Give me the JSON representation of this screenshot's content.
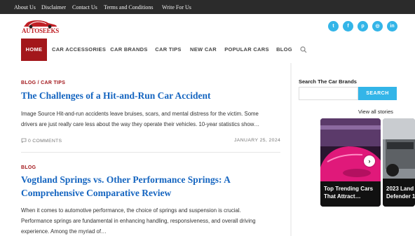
{
  "topbar": {
    "links": [
      "About Us",
      "Disclaimer",
      "Contact Us",
      "Terms and Conditions",
      "Write For Us"
    ]
  },
  "logo": {
    "text": "AUTOSEEKS"
  },
  "socials": [
    {
      "icon": "twitter-icon",
      "glyph": "t"
    },
    {
      "icon": "facebook-icon",
      "glyph": "f"
    },
    {
      "icon": "pinterest-icon",
      "glyph": "p"
    },
    {
      "icon": "instagram-icon",
      "glyph": "◎"
    },
    {
      "icon": "linkedin-icon",
      "glyph": "in"
    }
  ],
  "nav": {
    "items": [
      "HOME",
      "CAR ACCESSORIES",
      "CAR BRANDS",
      "CAR TIPS",
      "NEW CAR",
      "POPULAR CARS",
      "BLOG"
    ]
  },
  "posts": [
    {
      "category": "BLOG / CAR TIPS",
      "title": "The Challenges of a Hit-and-Run Car Accident",
      "excerpt_lines": [
        "Image Source Hit-and-run accidents leave bruises, scars, and mental distress for the victim. Some",
        "drivers are just really care less about the way they operate their vehicles. 10-year statistics show…"
      ],
      "comments": "0 COMMENTS",
      "date": "JANUARY 25, 2024"
    },
    {
      "category": "BLOG",
      "title_lines": [
        "Vogtland Springs vs. Other Performance Springs: A",
        "Comprehensive Comparative Review"
      ],
      "excerpt_lines": [
        "When it comes to automotive performance, the choice of springs and suspension is crucial.",
        "Performance springs are fundamental in enhancing handling, responsiveness, and overall driving",
        "experience. Among the myriad of…"
      ]
    }
  ],
  "sidebar": {
    "search_title": "Search The Car Brands",
    "search_placeholder": "",
    "search_button": "SEARCH",
    "view_all": "View all stories",
    "stories": [
      {
        "caption_lines": [
          "Top Trending Cars",
          "That Attract…"
        ]
      },
      {
        "caption_lines": [
          "2023 Land",
          "Defender 1"
        ]
      }
    ]
  },
  "colors": {
    "accent": "#a3171b",
    "link": "#1565c0",
    "social": "#33b5e8"
  }
}
